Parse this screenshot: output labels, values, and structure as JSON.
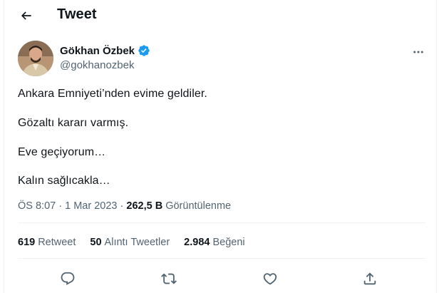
{
  "header": {
    "title": "Tweet",
    "back_icon": "arrow-left-icon"
  },
  "author": {
    "name": "Gökhan Özbek",
    "handle": "@gokhanozbek",
    "verified": true,
    "verified_color": "#1d9bf0"
  },
  "tweet": {
    "lines": [
      "Ankara Emniyeti’nden evime geldiler.",
      "Gözaltı kararı varmış.",
      "Eve geçiyorum…",
      "Kalın sağlıcakla…"
    ],
    "time": "ÖS 8:07",
    "separator": "·",
    "date": "1 Mar 2023",
    "views_count": "262,5 B",
    "views_label": "Görüntülenme"
  },
  "stats": {
    "retweets_count": "619",
    "retweets_label": "Retweet",
    "quotes_count": "50",
    "quotes_label": "Alıntı Tweetler",
    "likes_count": "2.984",
    "likes_label": "Beğeni"
  },
  "actions": [
    "reply-icon",
    "retweet-icon",
    "like-icon",
    "share-icon"
  ],
  "colors": {
    "text": "#0f1419",
    "secondary": "#536471",
    "accent": "#1d9bf0",
    "divider": "#eff3f4"
  }
}
